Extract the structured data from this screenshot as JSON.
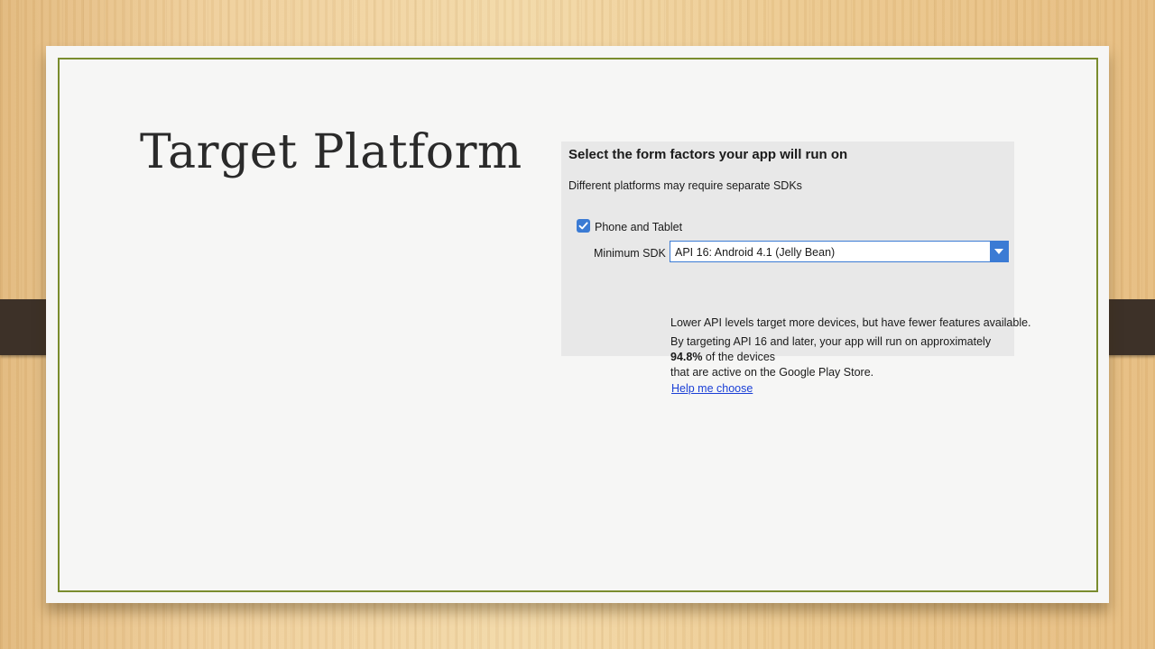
{
  "slide": {
    "title": "Target Platform"
  },
  "dialog": {
    "heading": "Select the form factors your app will run on",
    "subheading": "Different platforms may require separate SDKs",
    "phone_tablet": {
      "label": "Phone and Tablet",
      "checked": true
    },
    "min_sdk": {
      "label": "Minimum SDK",
      "value": "API 16: Android 4.1 (Jelly Bean)"
    },
    "info_line": "Lower API levels target more devices, but have fewer features available.",
    "coverage_line1": "By targeting API 16 and later, your app will run on approximately",
    "coverage_percent": "94.8%",
    "coverage_suffix": " of the devices",
    "coverage_line3": "that are active on the Google Play Store.",
    "help_link": "Help me choose"
  },
  "colors": {
    "accent": "#3b7bd4",
    "link": "#1a3fd6",
    "frame": "#7a8c2e",
    "band": "#3d3128"
  },
  "icons": {
    "check": "check-icon",
    "dropdown": "chevron-down-icon"
  }
}
